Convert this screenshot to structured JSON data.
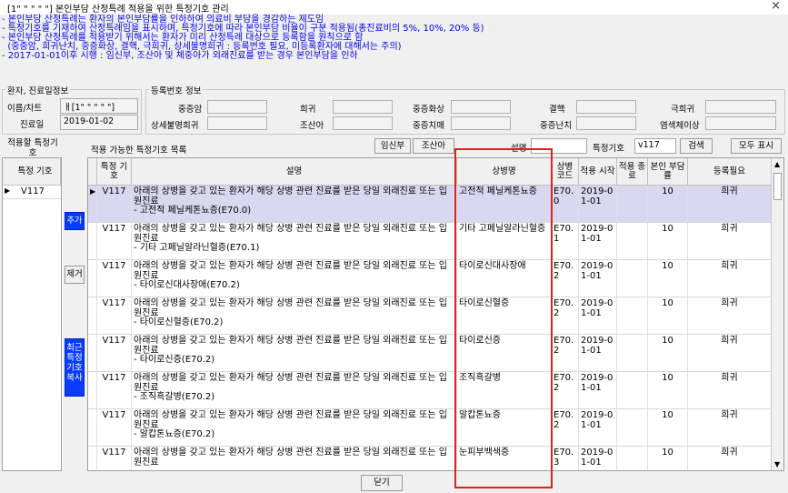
{
  "window": {
    "title": "[1\" \" \" \" \"] 본인부담 산정특례 적용을 위한 특정기호 관리",
    "close_label": "×"
  },
  "notices": [
    "- 본인부담 산정특례는 환자의 본인부담률을 인하하여 의료비 부담을 경감하는 제도임",
    "- 특정기호를 기재하여 산정특례임을 표시하며, 특정기호에 따라 본인부담 비율이 구분 적용됨(총진료비의 5%, 10%, 20% 등)",
    "- 본인부담 산정특례를 적용받기 위해서는 환자가 미리 산정특례 대상으로 등록함을 원칙으로 함",
    "  (중증암, 희귀난치, 중증화상, 결핵, 극희귀, 상세불명희귀 : 등록번호 필요, 미등록환자에 대해서는 주의)",
    "- 2017-01-01이후 시행 : 임신부, 조산아 및 체중아가 외래진료를 받는 경우 본인부담을 인하"
  ],
  "patient_group": {
    "title": "환자, 진료일정보",
    "name_label": "이름/차트",
    "name_value": "ㅐ[1\" \" \" \" \"]",
    "date_label": "진료일",
    "date_value": "2019-01-02"
  },
  "reg_group": {
    "title": "등록번호 정보",
    "labels": [
      "중증암",
      "희귀",
      "중증화상",
      "결핵",
      "극희귀",
      "상세불명희귀",
      "조산아",
      "중증치매",
      "중증난치",
      "염색체이상"
    ]
  },
  "left_panel": {
    "title": "적용할 특정기호",
    "col_header": "특정 기호",
    "rows": [
      "V117"
    ],
    "add_label": "추가",
    "remove_label": "제거",
    "copy_label": "최근 특정 기호 복사"
  },
  "toolbar": {
    "list_title": "적용 가능한 특정기호 목록",
    "pregnant_button": "임신부",
    "premature_button": "조산아",
    "desc_label": "설명",
    "desc_value": "",
    "code_label": "특정기호",
    "code_value": "v117",
    "search_button": "검색",
    "show_all_button": "모두 표시"
  },
  "table": {
    "columns": [
      "특정 기호",
      "설명",
      "상병명",
      "상병 코드",
      "적용 시작",
      "적용 종료",
      "본인 부담률",
      "등록필요"
    ],
    "rows": [
      {
        "code": "V117",
        "desc": [
          "아래의 상병을 갖고 있는 환자가 해당 상병 관련 진료를 받은 당일 외래진료 또는 입원진료",
          "- 고전적 페닐케톤뇨증(E70.0)"
        ],
        "disease": "고전적 페닐케톤뇨증",
        "dcode": "E70.0",
        "start": "2019-01-01",
        "end": "",
        "rate": "10",
        "reg": "희귀"
      },
      {
        "code": "V117",
        "desc": [
          "아래의 상병을 갖고 있는 환자가 해당 상병 관련 진료를 받은 당일 외래진료 또는 입원진료",
          "- 기타 고페닐알라닌혈증(E70.1)"
        ],
        "disease": "기타 고페닐알라닌혈증",
        "dcode": "E70.1",
        "start": "2019-01-01",
        "end": "",
        "rate": "10",
        "reg": "희귀"
      },
      {
        "code": "V117",
        "desc": [
          "아래의 상병을 갖고 있는 환자가 해당 상병 관련 진료를 받은 당일 외래진료 또는 입원진료",
          "- 타이로신대사장애(E70.2)"
        ],
        "disease": "타이로신대사장애",
        "dcode": "E70.2",
        "start": "2019-01-01",
        "end": "",
        "rate": "10",
        "reg": "희귀"
      },
      {
        "code": "V117",
        "desc": [
          "아래의 상병을 갖고 있는 환자가 해당 상병 관련 진료를 받은 당일 외래진료 또는 입원진료",
          "- 타이로신혈증(E70.2)"
        ],
        "disease": "타이로신혈증",
        "dcode": "E70.2",
        "start": "2019-01-01",
        "end": "",
        "rate": "10",
        "reg": "희귀"
      },
      {
        "code": "V117",
        "desc": [
          "아래의 상병을 갖고 있는 환자가 해당 상병 관련 진료를 받은 당일 외래진료 또는 입원진료",
          "- 타이로신증(E70.2)"
        ],
        "disease": "타이로신증",
        "dcode": "E70.2",
        "start": "2019-01-01",
        "end": "",
        "rate": "10",
        "reg": "희귀"
      },
      {
        "code": "V117",
        "desc": [
          "아래의 상병을 갖고 있는 환자가 해당 상병 관련 진료를 받은 당일 외래진료 또는 입원진료",
          "- 조직흑갈병(E70.2)"
        ],
        "disease": "조직흑갈병",
        "dcode": "E70.2",
        "start": "2019-01-01",
        "end": "",
        "rate": "10",
        "reg": "희귀"
      },
      {
        "code": "V117",
        "desc": [
          "아래의 상병을 갖고 있는 환자가 해당 상병 관련 진료를 받은 당일 외래진료 또는 입원진료",
          "- 알캅톤뇨증(E70.2)"
        ],
        "disease": "알캅톤뇨증",
        "dcode": "E70.2",
        "start": "2019-01-01",
        "end": "",
        "rate": "10",
        "reg": "희귀"
      },
      {
        "code": "V117",
        "desc": [
          "아래의 상병을 갖고 있는 환자가 해당 상병 관련 진료를 받은 당일 외래진료 또는 입원진료"
        ],
        "disease": "눈피부백색증",
        "dcode": "E70.3",
        "start": "2019-01-01",
        "end": "",
        "rate": "10",
        "reg": "희귀"
      }
    ]
  },
  "footer": {
    "close_button": "닫기"
  },
  "colors": {
    "notice": "#0000ee",
    "accent_button": "#0a3cff",
    "highlight_box": "#e0201c",
    "selected_row": "#d8d8f0"
  }
}
